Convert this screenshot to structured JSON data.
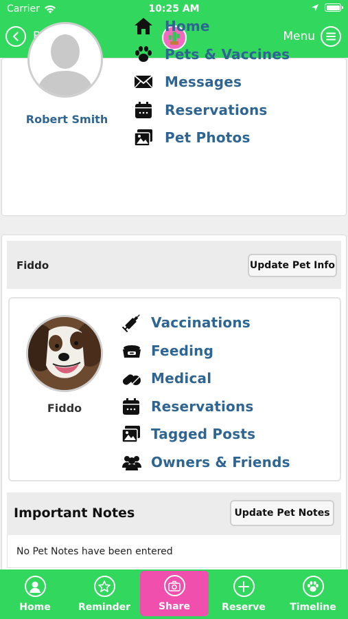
{
  "status_bar": {
    "carrier": "Carrier",
    "time": "10:25 AM"
  },
  "nav": {
    "back_label": "Back",
    "menu_label": "Menu"
  },
  "user": {
    "name": "Robert Smith",
    "menu": [
      {
        "label": "Home",
        "icon": "house-icon"
      },
      {
        "label": "Pets & Vaccines",
        "icon": "paw-icon"
      },
      {
        "label": "Messages",
        "icon": "envelope-icon"
      },
      {
        "label": "Reservations",
        "icon": "calendar-icon"
      },
      {
        "label": "Pet Photos",
        "icon": "photos-icon"
      }
    ]
  },
  "pet": {
    "header_name": "Fiddo",
    "update_info_label": "Update Pet Info",
    "name": "Fiddo",
    "menu": [
      {
        "label": "Vaccinations",
        "icon": "syringe-icon"
      },
      {
        "label": "Feeding",
        "icon": "food-bowl-icon"
      },
      {
        "label": "Medical",
        "icon": "pills-icon"
      },
      {
        "label": "Reservations",
        "icon": "calendar-icon"
      },
      {
        "label": "Tagged Posts",
        "icon": "photos-icon"
      },
      {
        "label": "Owners & Friends",
        "icon": "users-icon"
      }
    ]
  },
  "notes": {
    "title": "Important Notes",
    "update_label": "Update Pet Notes",
    "empty_text": "No Pet Notes have been entered"
  },
  "tabs": [
    {
      "label": "Home",
      "icon": "user-icon"
    },
    {
      "label": "Reminder",
      "icon": "star-icon"
    },
    {
      "label": "Share",
      "icon": "camera-icon"
    },
    {
      "label": "Reserve",
      "icon": "plus-icon"
    },
    {
      "label": "Timeline",
      "icon": "paw-icon"
    }
  ],
  "colors": {
    "header_green": "#32d85e",
    "link_blue": "#2e6592",
    "share_pink": "#f04fae"
  }
}
